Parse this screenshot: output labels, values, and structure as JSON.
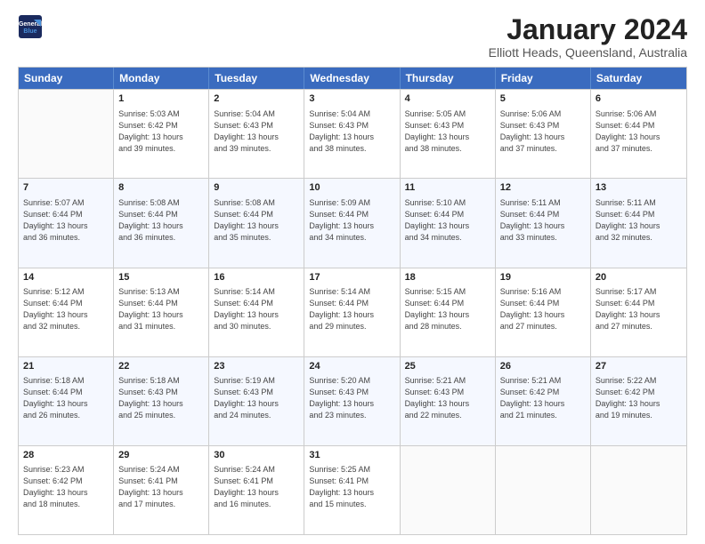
{
  "logo": {
    "line1": "General",
    "line2": "Blue"
  },
  "title": "January 2024",
  "location": "Elliott Heads, Queensland, Australia",
  "days_of_week": [
    "Sunday",
    "Monday",
    "Tuesday",
    "Wednesday",
    "Thursday",
    "Friday",
    "Saturday"
  ],
  "weeks": [
    [
      {
        "day": "",
        "data": ""
      },
      {
        "day": "1",
        "data": "Sunrise: 5:03 AM\nSunset: 6:42 PM\nDaylight: 13 hours\nand 39 minutes."
      },
      {
        "day": "2",
        "data": "Sunrise: 5:04 AM\nSunset: 6:43 PM\nDaylight: 13 hours\nand 39 minutes."
      },
      {
        "day": "3",
        "data": "Sunrise: 5:04 AM\nSunset: 6:43 PM\nDaylight: 13 hours\nand 38 minutes."
      },
      {
        "day": "4",
        "data": "Sunrise: 5:05 AM\nSunset: 6:43 PM\nDaylight: 13 hours\nand 38 minutes."
      },
      {
        "day": "5",
        "data": "Sunrise: 5:06 AM\nSunset: 6:43 PM\nDaylight: 13 hours\nand 37 minutes."
      },
      {
        "day": "6",
        "data": "Sunrise: 5:06 AM\nSunset: 6:44 PM\nDaylight: 13 hours\nand 37 minutes."
      }
    ],
    [
      {
        "day": "7",
        "data": "Sunrise: 5:07 AM\nSunset: 6:44 PM\nDaylight: 13 hours\nand 36 minutes."
      },
      {
        "day": "8",
        "data": "Sunrise: 5:08 AM\nSunset: 6:44 PM\nDaylight: 13 hours\nand 36 minutes."
      },
      {
        "day": "9",
        "data": "Sunrise: 5:08 AM\nSunset: 6:44 PM\nDaylight: 13 hours\nand 35 minutes."
      },
      {
        "day": "10",
        "data": "Sunrise: 5:09 AM\nSunset: 6:44 PM\nDaylight: 13 hours\nand 34 minutes."
      },
      {
        "day": "11",
        "data": "Sunrise: 5:10 AM\nSunset: 6:44 PM\nDaylight: 13 hours\nand 34 minutes."
      },
      {
        "day": "12",
        "data": "Sunrise: 5:11 AM\nSunset: 6:44 PM\nDaylight: 13 hours\nand 33 minutes."
      },
      {
        "day": "13",
        "data": "Sunrise: 5:11 AM\nSunset: 6:44 PM\nDaylight: 13 hours\nand 32 minutes."
      }
    ],
    [
      {
        "day": "14",
        "data": "Sunrise: 5:12 AM\nSunset: 6:44 PM\nDaylight: 13 hours\nand 32 minutes."
      },
      {
        "day": "15",
        "data": "Sunrise: 5:13 AM\nSunset: 6:44 PM\nDaylight: 13 hours\nand 31 minutes."
      },
      {
        "day": "16",
        "data": "Sunrise: 5:14 AM\nSunset: 6:44 PM\nDaylight: 13 hours\nand 30 minutes."
      },
      {
        "day": "17",
        "data": "Sunrise: 5:14 AM\nSunset: 6:44 PM\nDaylight: 13 hours\nand 29 minutes."
      },
      {
        "day": "18",
        "data": "Sunrise: 5:15 AM\nSunset: 6:44 PM\nDaylight: 13 hours\nand 28 minutes."
      },
      {
        "day": "19",
        "data": "Sunrise: 5:16 AM\nSunset: 6:44 PM\nDaylight: 13 hours\nand 27 minutes."
      },
      {
        "day": "20",
        "data": "Sunrise: 5:17 AM\nSunset: 6:44 PM\nDaylight: 13 hours\nand 27 minutes."
      }
    ],
    [
      {
        "day": "21",
        "data": "Sunrise: 5:18 AM\nSunset: 6:44 PM\nDaylight: 13 hours\nand 26 minutes."
      },
      {
        "day": "22",
        "data": "Sunrise: 5:18 AM\nSunset: 6:43 PM\nDaylight: 13 hours\nand 25 minutes."
      },
      {
        "day": "23",
        "data": "Sunrise: 5:19 AM\nSunset: 6:43 PM\nDaylight: 13 hours\nand 24 minutes."
      },
      {
        "day": "24",
        "data": "Sunrise: 5:20 AM\nSunset: 6:43 PM\nDaylight: 13 hours\nand 23 minutes."
      },
      {
        "day": "25",
        "data": "Sunrise: 5:21 AM\nSunset: 6:43 PM\nDaylight: 13 hours\nand 22 minutes."
      },
      {
        "day": "26",
        "data": "Sunrise: 5:21 AM\nSunset: 6:42 PM\nDaylight: 13 hours\nand 21 minutes."
      },
      {
        "day": "27",
        "data": "Sunrise: 5:22 AM\nSunset: 6:42 PM\nDaylight: 13 hours\nand 19 minutes."
      }
    ],
    [
      {
        "day": "28",
        "data": "Sunrise: 5:23 AM\nSunset: 6:42 PM\nDaylight: 13 hours\nand 18 minutes."
      },
      {
        "day": "29",
        "data": "Sunrise: 5:24 AM\nSunset: 6:41 PM\nDaylight: 13 hours\nand 17 minutes."
      },
      {
        "day": "30",
        "data": "Sunrise: 5:24 AM\nSunset: 6:41 PM\nDaylight: 13 hours\nand 16 minutes."
      },
      {
        "day": "31",
        "data": "Sunrise: 5:25 AM\nSunset: 6:41 PM\nDaylight: 13 hours\nand 15 minutes."
      },
      {
        "day": "",
        "data": ""
      },
      {
        "day": "",
        "data": ""
      },
      {
        "day": "",
        "data": ""
      }
    ]
  ]
}
